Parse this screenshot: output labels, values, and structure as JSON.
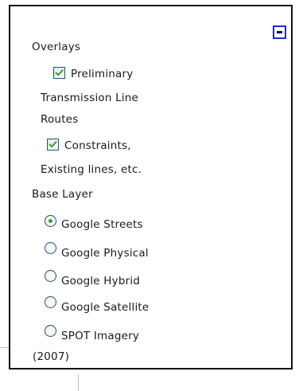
{
  "overlays": {
    "heading": "Overlays",
    "items": [
      {
        "lines": [
          "Preliminary",
          "Transmission Line",
          "Routes"
        ],
        "checked": true
      },
      {
        "lines": [
          "Constraints,",
          "Existing lines, etc."
        ],
        "checked": true
      }
    ]
  },
  "base_layer": {
    "heading": "Base Layer",
    "selected": "Google Streets",
    "items": [
      {
        "lines": [
          "Google Streets"
        ],
        "selected": true
      },
      {
        "lines": [
          "Google Physical"
        ],
        "selected": false
      },
      {
        "lines": [
          "Google Hybrid"
        ],
        "selected": false
      },
      {
        "lines": [
          "Google Satellite"
        ],
        "selected": false
      },
      {
        "lines": [
          "SPOT Imagery",
          "(2007)"
        ],
        "selected": false
      }
    ]
  },
  "icons": {
    "minimize": "minimize-icon",
    "checkmark": "checkmark-icon"
  },
  "colors": {
    "control_border": "#1c5180",
    "check_mark": "#2fa52f",
    "minimize_border": "#1d2ec4",
    "panel_border": "#111111"
  }
}
